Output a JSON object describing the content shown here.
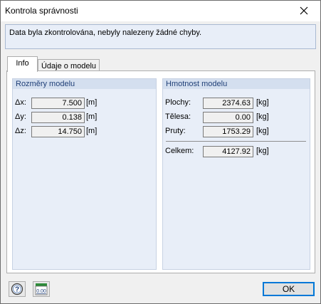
{
  "window": {
    "title": "Kontrola správnosti"
  },
  "message": {
    "text": "Data byla zkontrolována, nebyly nalezeny žádné chyby."
  },
  "tabs": [
    {
      "label": "Info",
      "active": true
    },
    {
      "label": "Údaje o modelu",
      "active": false
    }
  ],
  "dimensions": {
    "header": "Rozměry modelu",
    "rows": [
      {
        "label": "Δx:",
        "value": "7.500",
        "unit": "[m]"
      },
      {
        "label": "Δy:",
        "value": "0.138",
        "unit": "[m]"
      },
      {
        "label": "Δz:",
        "value": "14.750",
        "unit": "[m]"
      }
    ]
  },
  "mass": {
    "header": "Hmotnost modelu",
    "rows": [
      {
        "label": "Plochy:",
        "value": "2374.63",
        "unit": "[kg]"
      },
      {
        "label": "Tělesa:",
        "value": "0.00",
        "unit": "[kg]"
      },
      {
        "label": "Pruty:",
        "value": "1753.29",
        "unit": "[kg]"
      }
    ],
    "total": {
      "label": "Celkem:",
      "value": "4127.92",
      "unit": "[kg]"
    }
  },
  "buttons": {
    "ok": "OK",
    "help_icon": "help-icon",
    "units_icon": "units-icon",
    "units_icon_text": "0.00"
  }
}
